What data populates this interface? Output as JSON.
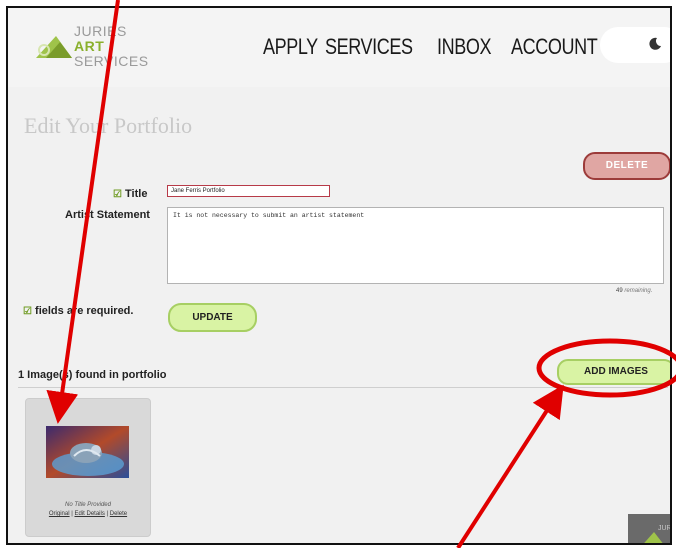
{
  "header": {
    "logo": {
      "line1": "JURIES",
      "line2": "ART",
      "line3": "SERVICES"
    },
    "nav": [
      "APPLY",
      "SERVICES",
      "INBOX",
      "ACCOUNT"
    ]
  },
  "page": {
    "title": "Edit Your Portfolio"
  },
  "form": {
    "delete_label": "DELETE",
    "title_check": "☑",
    "title_label": "Title",
    "title_value": "Jane Ferris Portfolio",
    "statement_label": "Artist Statement",
    "statement_value": "It is not necessary to submit an artist statement",
    "remaining_count": "49",
    "remaining_text": "remaining.",
    "required_check": "☑",
    "required_note": "fields are required.",
    "update_label": "UPDATE"
  },
  "images": {
    "count_text": "1 Image(s) found in portfolio",
    "add_label": "ADD IMAGES",
    "items": [
      {
        "caption": "No Title Provided",
        "links": [
          "Original",
          "Edit Details",
          "Delete"
        ]
      }
    ]
  },
  "colors": {
    "accent_green": "#8ab02d",
    "delete_red": "#9c3b3a",
    "annotation_red": "#e00000"
  }
}
